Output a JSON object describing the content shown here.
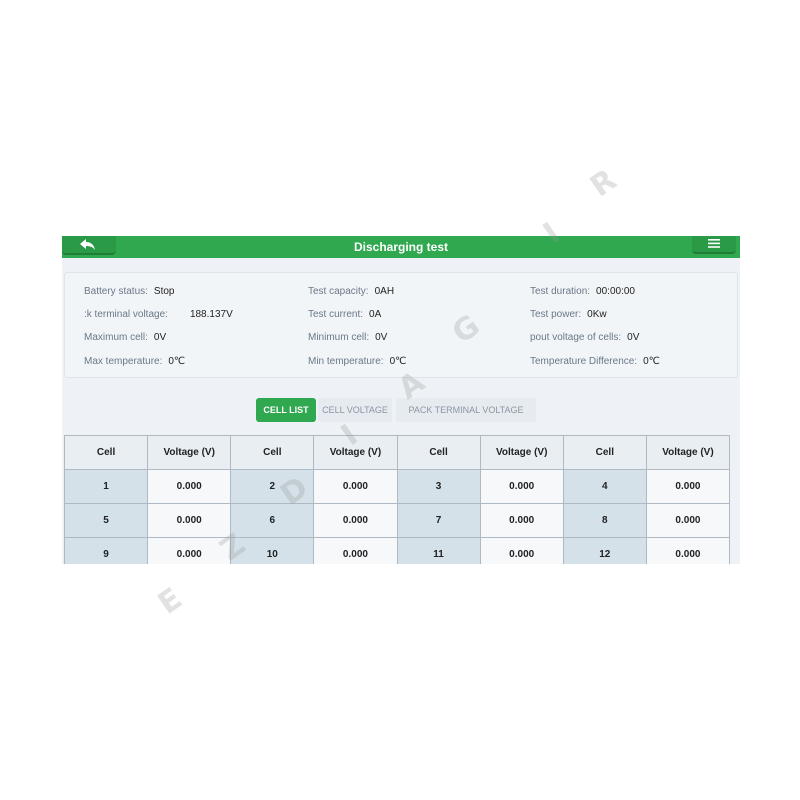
{
  "titlebar": {
    "title": "Discharging test"
  },
  "info": {
    "battery_status": {
      "label": "Battery status:",
      "value": "Stop"
    },
    "pack_terminal_voltage": {
      "label": ":k terminal voltage:",
      "value": "188.137V"
    },
    "maximum_cell": {
      "label": "Maximum cell:",
      "value": "0V"
    },
    "max_temperature": {
      "label": "Max temperature:",
      "value": "0℃"
    },
    "test_capacity": {
      "label": "Test capacity:",
      "value": "0AH"
    },
    "test_current": {
      "label": "Test current:",
      "value": "0A"
    },
    "minimum_cell": {
      "label": "Minimum cell:",
      "value": "0V"
    },
    "min_temperature": {
      "label": "Min temperature:",
      "value": "0℃"
    },
    "test_duration": {
      "label": "Test duration:",
      "value": "00:00:00"
    },
    "test_power": {
      "label": "Test power:",
      "value": "0Kw"
    },
    "output_voltage_of_cells": {
      "label": "pout voltage of cells:",
      "value": "0V"
    },
    "temperature_difference": {
      "label": "Temperature Difference:",
      "value": "0℃"
    }
  },
  "tabs": [
    {
      "label": "CELL LIST",
      "active": true
    },
    {
      "label": "CELL VOLTAGE",
      "active": false
    },
    {
      "label": "PACK TERMINAL VOLTAGE",
      "active": false
    }
  ],
  "table": {
    "headers": [
      "Cell",
      "Voltage (V)",
      "Cell",
      "Voltage (V)",
      "Cell",
      "Voltage (V)",
      "Cell",
      "Voltage (V)"
    ],
    "rows": [
      [
        {
          "cell": "1",
          "voltage": "0.000"
        },
        {
          "cell": "2",
          "voltage": "0.000"
        },
        {
          "cell": "3",
          "voltage": "0.000"
        },
        {
          "cell": "4",
          "voltage": "0.000"
        }
      ],
      [
        {
          "cell": "5",
          "voltage": "0.000"
        },
        {
          "cell": "6",
          "voltage": "0.000"
        },
        {
          "cell": "7",
          "voltage": "0.000"
        },
        {
          "cell": "8",
          "voltage": "0.000"
        }
      ],
      [
        {
          "cell": "9",
          "voltage": "0.000"
        },
        {
          "cell": "10",
          "voltage": "0.000"
        },
        {
          "cell": "11",
          "voltage": "0.000"
        },
        {
          "cell": "12",
          "voltage": "0.000"
        }
      ]
    ]
  },
  "watermark": [
    "E",
    "Z",
    "D",
    "I",
    "A",
    "G",
    "I",
    "R"
  ],
  "colors": {
    "accent": "#2fa84f",
    "background": "#eef2f6"
  },
  "icons": {
    "back": "back-arrow-icon",
    "menu": "menu-icon"
  }
}
